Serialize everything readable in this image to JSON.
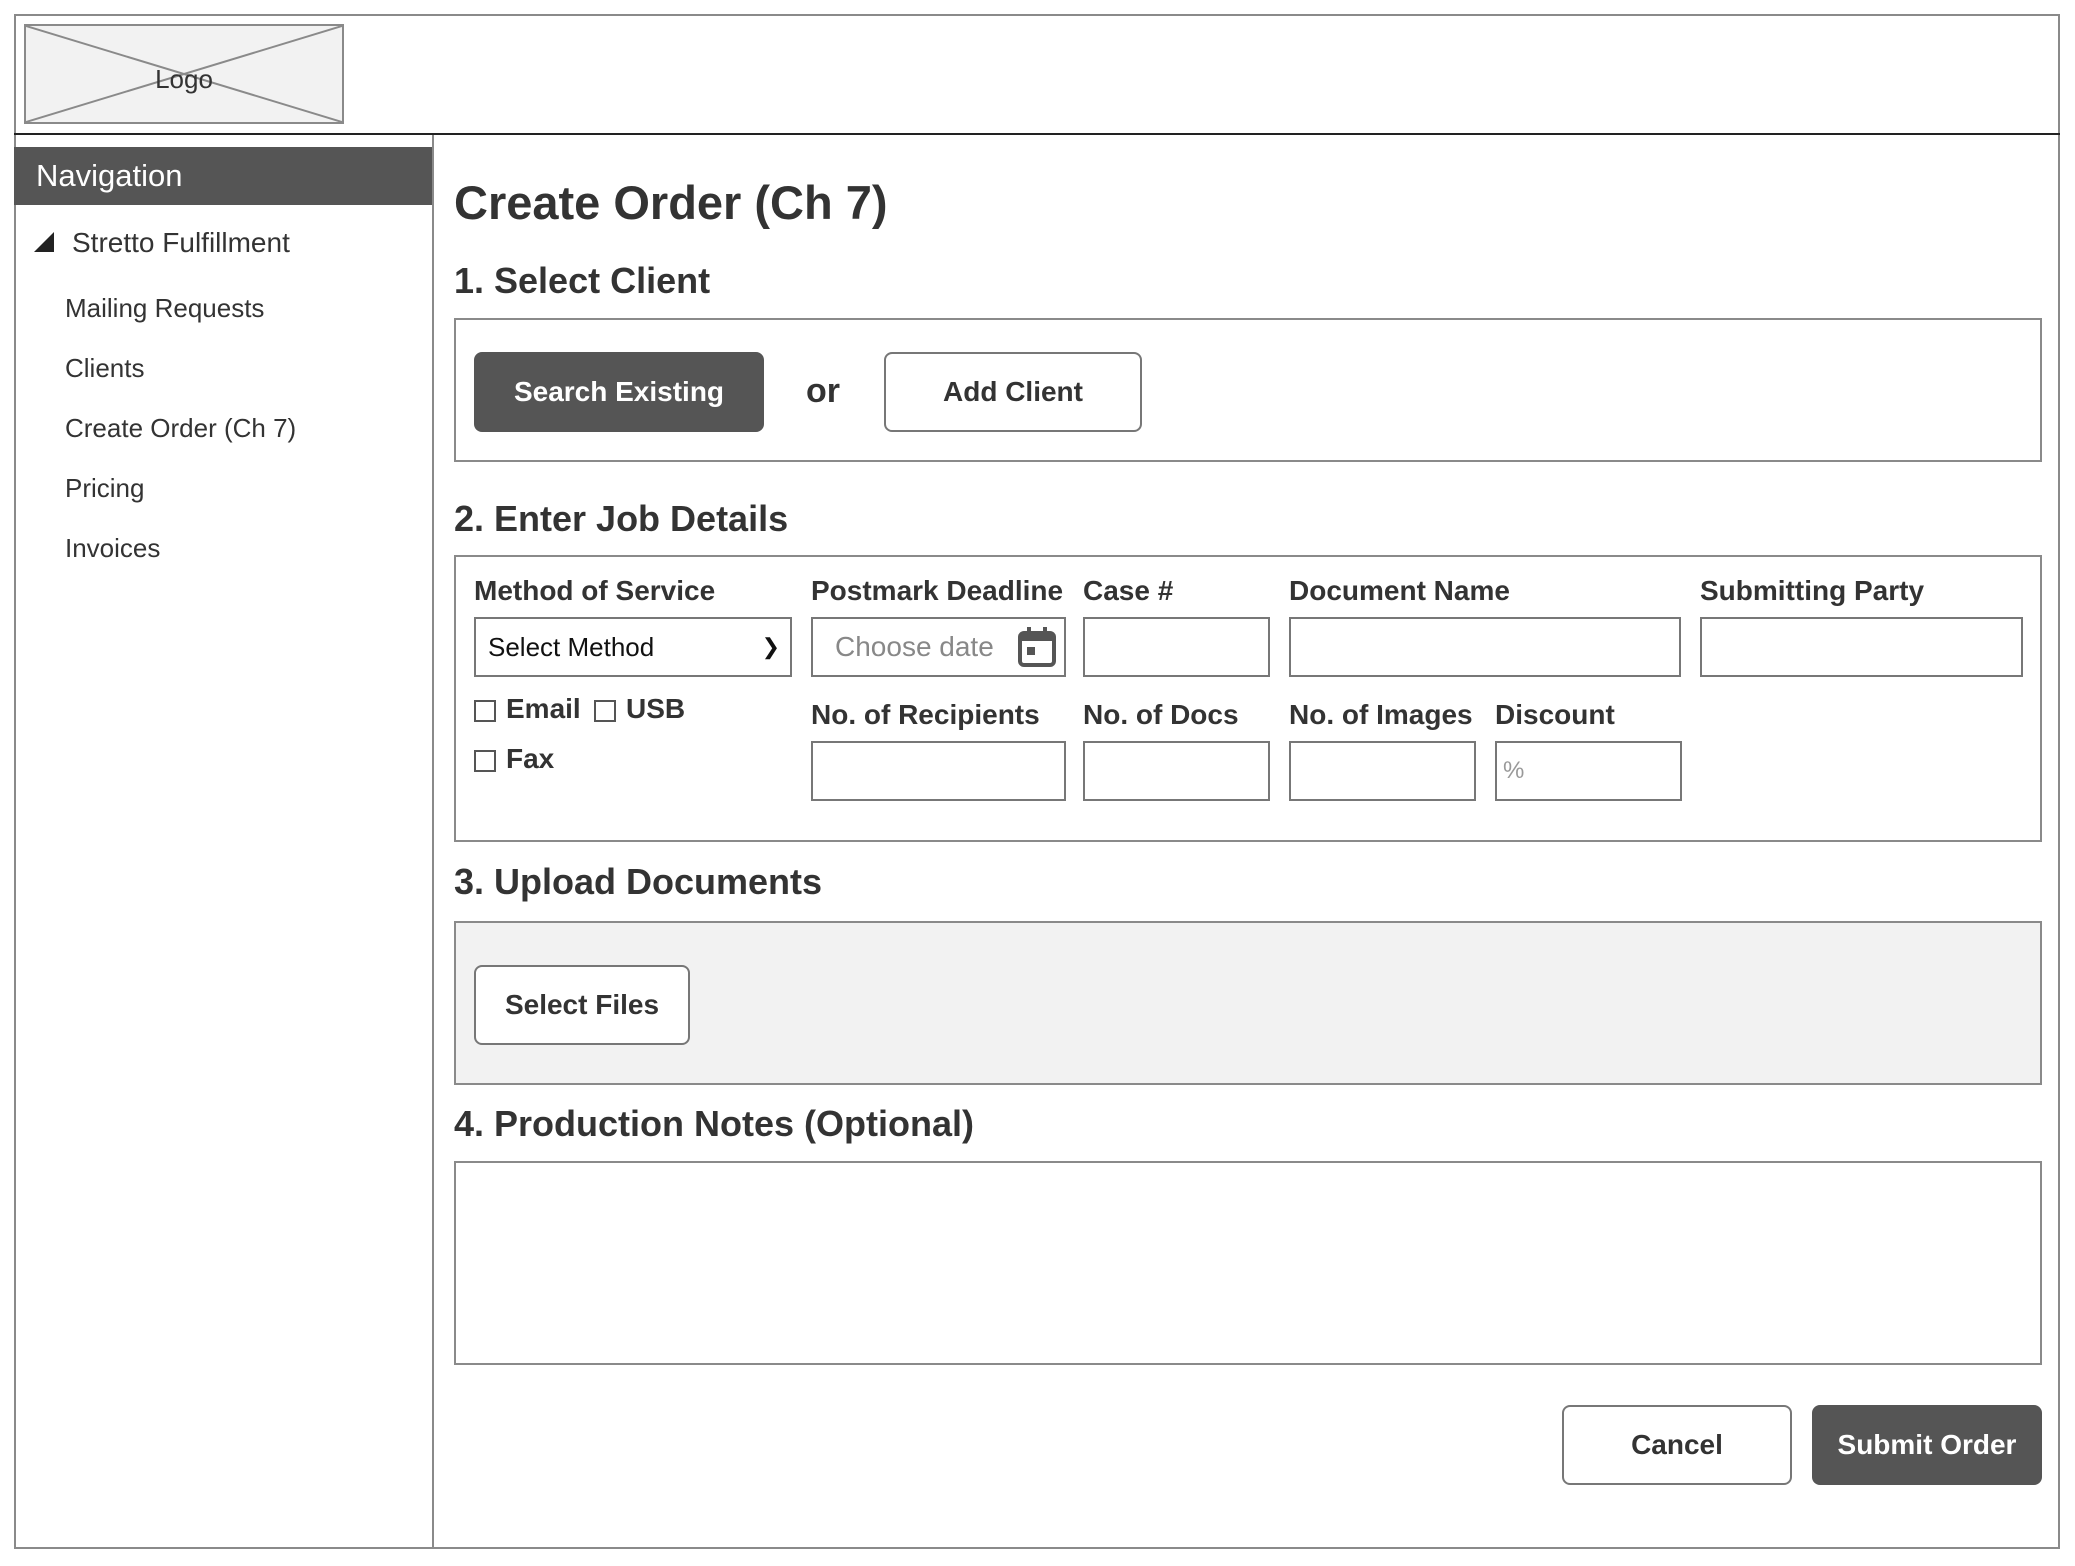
{
  "header": {
    "logo_text": "Logo"
  },
  "nav": {
    "title": "Navigation",
    "group": "Stretto Fulfillment",
    "items": [
      "Mailing Requests",
      "Clients",
      "Create Order (Ch 7)",
      "Pricing",
      "Invoices"
    ]
  },
  "page": {
    "title": "Create Order (Ch 7)"
  },
  "section1": {
    "title": "1. Select Client",
    "search_button": "Search Existing",
    "or_text": "or",
    "add_button": "Add Client"
  },
  "section2": {
    "title": "2. Enter Job Details",
    "method_label": "Method of Service",
    "method_value": "Select Method",
    "deadline_label": "Postmark Deadline",
    "deadline_placeholder": "Choose date",
    "case_label": "Case #",
    "docname_label": "Document Name",
    "party_label": "Submitting Party",
    "email_label": "Email",
    "usb_label": "USB",
    "fax_label": "Fax",
    "recipients_label": "No. of Recipients",
    "docs_label": "No. of Docs",
    "images_label": "No. of Images",
    "discount_label": "Discount",
    "discount_placeholder": "%"
  },
  "section3": {
    "title": "3. Upload Documents",
    "select_button": "Select Files"
  },
  "section4": {
    "title": "4. Production Notes (Optional)"
  },
  "footer": {
    "cancel_button": "Cancel",
    "submit_button": "Submit Order"
  }
}
